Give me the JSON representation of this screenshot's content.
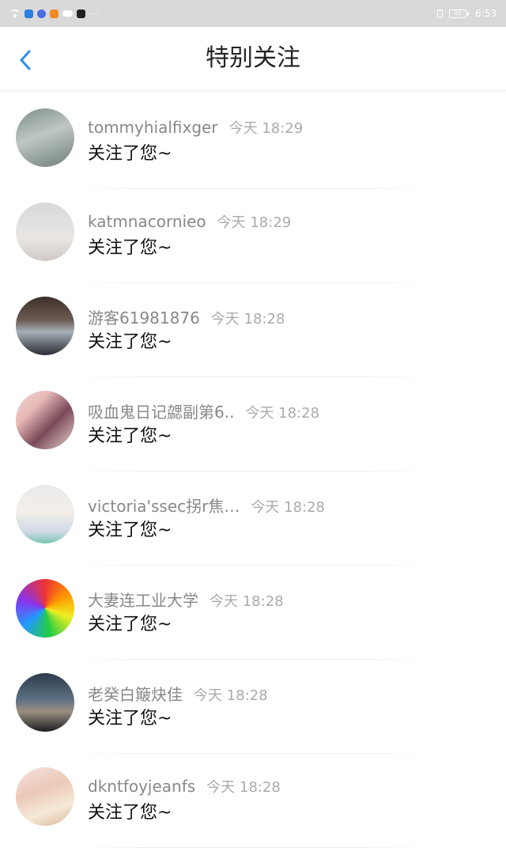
{
  "status_bar": {
    "time": "6:53",
    "battery_level": "85",
    "colors": {
      "background": "#d9d9d9",
      "icons": "#ffffff"
    }
  },
  "nav": {
    "title": "特别关注",
    "back_icon": "chevron-left-icon",
    "accent": "#2d8cf0"
  },
  "items": [
    {
      "name": "tommyhialfixger",
      "time": "今天 18:29",
      "message": "关注了您~",
      "avatar": {
        "bg": "linear-gradient(160deg,#7c8e86 0%,#bfc7c3 45%,#9aa6a0 70%,#6e7f78 100%)",
        "shape": "cat"
      }
    },
    {
      "name": "katmnacornieo",
      "time": "今天 18:29",
      "message": "关注了您~",
      "avatar": {
        "bg": "linear-gradient(180deg,#d8d8d8 0%,#e9e6e4 60%,#cfcac7 100%)",
        "shape": "face-mask"
      }
    },
    {
      "name": "游客61981876",
      "time": "今天 18:28",
      "message": "关注了您~",
      "avatar": {
        "bg": "linear-gradient(180deg,#3e2f2a 0%,#6b5a52 40%,#a7b0b8 60%,#2a2c33 100%)",
        "shape": "car"
      }
    },
    {
      "name": "吸血鬼日记勰副第6..",
      "time": "今天 18:28",
      "message": "关注了您~",
      "avatar": {
        "bg": "linear-gradient(135deg,#f1d9d4 0%,#e7b8b6 30%,#7a4a5a 60%,#e9d6cf 100%)",
        "shape": "anime"
      }
    },
    {
      "name": "victoria'ssec拐r焦…",
      "time": "今天 18:28",
      "message": "关注了您~",
      "avatar": {
        "bg": "linear-gradient(180deg,#eaeaea 0%,#f4efe9 45%,#cfd9e6 80%,#7bc6b2 100%)",
        "shape": "girl"
      }
    },
    {
      "name": "大妻连工业大学",
      "time": "今天 18:28",
      "message": "关注了您~",
      "avatar": {
        "bg": "conic-gradient(#e33 0deg,#f90 60deg,#ee2 110deg,#2c4 170deg,#29f 230deg,#83e 290deg,#e33 360deg)",
        "shape": "rose"
      }
    },
    {
      "name": "老癸白簸炔佳",
      "time": "今天 18:28",
      "message": "关注了您~",
      "avatar": {
        "bg": "linear-gradient(180deg,#2d3a4a 0%,#5d7184 45%,#9b8f82 65%,#1c1f24 100%)",
        "shape": "sunset"
      }
    },
    {
      "name": "dkntfoyjeanfs",
      "time": "今天 18:28",
      "message": "关注了您~",
      "avatar": {
        "bg": "linear-gradient(160deg,#f3e1dc 0%,#ecc9b8 40%,#f6e8d6 70%,#d7b89c 100%)",
        "shape": "blossom"
      }
    }
  ]
}
